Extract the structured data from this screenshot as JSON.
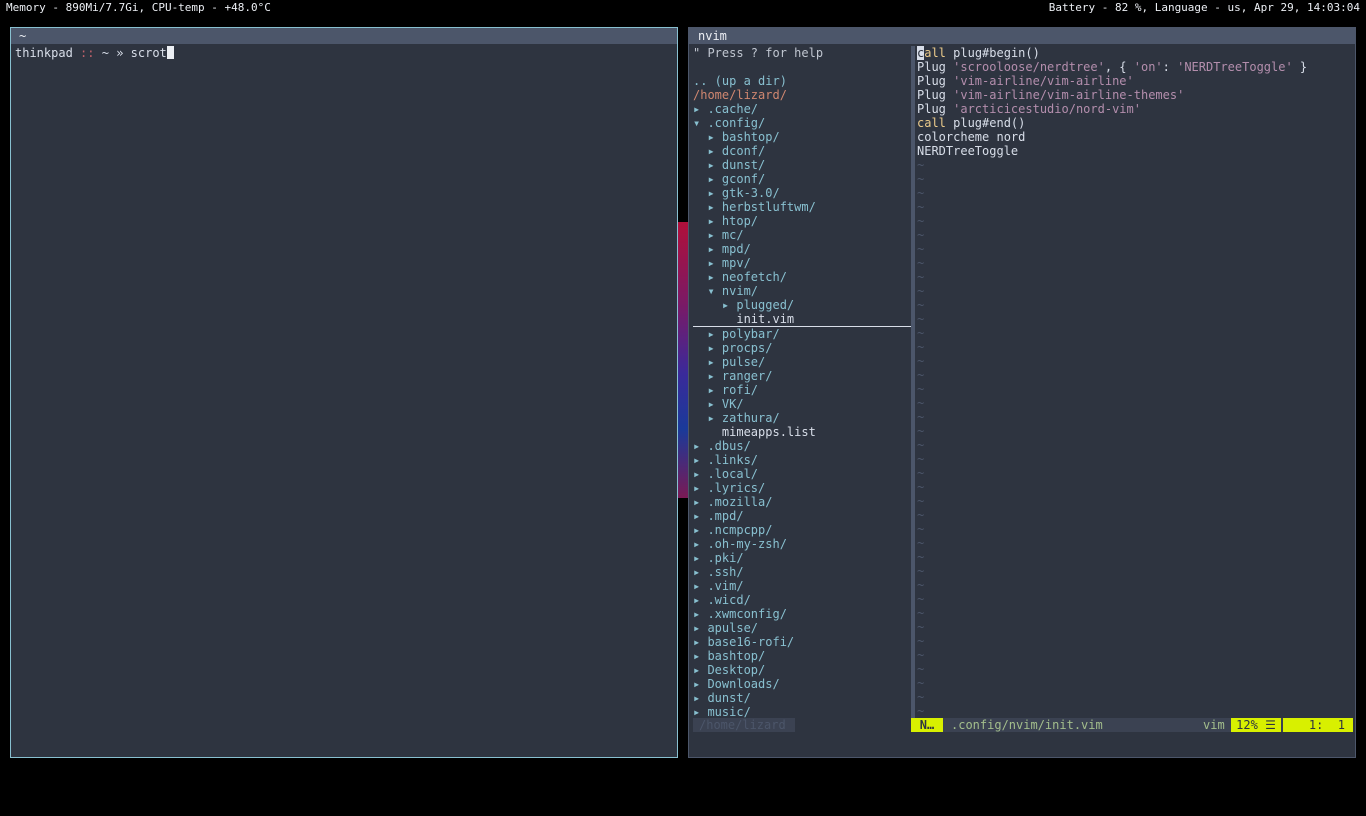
{
  "topbar": {
    "left": "Memory - 890Mi/7.7Gi, CPU-temp - +48.0°C",
    "right": "Battery - 82 %, Language - us, Apr 29, 14:03:04"
  },
  "terminal": {
    "title": "~",
    "host": "thinkpad",
    "sep": "::",
    "path": "~",
    "arrow": "»",
    "command": "scrot"
  },
  "nvim": {
    "title": "nvim",
    "tree": {
      "help": "\" Press ? for help",
      "updir": ".. (up a dir)",
      "root": "/home/lizard/",
      "items": [
        {
          "arrow": "▸",
          "indent": 0,
          "name": ".cache/"
        },
        {
          "arrow": "▾",
          "indent": 0,
          "name": ".config/"
        },
        {
          "arrow": "▸",
          "indent": 1,
          "name": "bashtop/"
        },
        {
          "arrow": "▸",
          "indent": 1,
          "name": "dconf/"
        },
        {
          "arrow": "▸",
          "indent": 1,
          "name": "dunst/"
        },
        {
          "arrow": "▸",
          "indent": 1,
          "name": "gconf/"
        },
        {
          "arrow": "▸",
          "indent": 1,
          "name": "gtk-3.0/"
        },
        {
          "arrow": "▸",
          "indent": 1,
          "name": "herbstluftwm/"
        },
        {
          "arrow": "▸",
          "indent": 1,
          "name": "htop/"
        },
        {
          "arrow": "▸",
          "indent": 1,
          "name": "mc/"
        },
        {
          "arrow": "▸",
          "indent": 1,
          "name": "mpd/"
        },
        {
          "arrow": "▸",
          "indent": 1,
          "name": "mpv/"
        },
        {
          "arrow": "▸",
          "indent": 1,
          "name": "neofetch/"
        },
        {
          "arrow": "▾",
          "indent": 1,
          "name": "nvim/"
        },
        {
          "arrow": "▸",
          "indent": 2,
          "name": "plugged/"
        },
        {
          "arrow": "",
          "indent": 2,
          "name": "init.vim",
          "file": true,
          "selected": true
        },
        {
          "arrow": "▸",
          "indent": 1,
          "name": "polybar/"
        },
        {
          "arrow": "▸",
          "indent": 1,
          "name": "procps/"
        },
        {
          "arrow": "▸",
          "indent": 1,
          "name": "pulse/"
        },
        {
          "arrow": "▸",
          "indent": 1,
          "name": "ranger/"
        },
        {
          "arrow": "▸",
          "indent": 1,
          "name": "rofi/"
        },
        {
          "arrow": "▸",
          "indent": 1,
          "name": "VK/"
        },
        {
          "arrow": "▸",
          "indent": 1,
          "name": "zathura/"
        },
        {
          "arrow": "",
          "indent": 1,
          "name": "mimeapps.list",
          "file": true
        },
        {
          "arrow": "▸",
          "indent": 0,
          "name": ".dbus/"
        },
        {
          "arrow": "▸",
          "indent": 0,
          "name": ".links/"
        },
        {
          "arrow": "▸",
          "indent": 0,
          "name": ".local/"
        },
        {
          "arrow": "▸",
          "indent": 0,
          "name": ".lyrics/"
        },
        {
          "arrow": "▸",
          "indent": 0,
          "name": ".mozilla/"
        },
        {
          "arrow": "▸",
          "indent": 0,
          "name": ".mpd/"
        },
        {
          "arrow": "▸",
          "indent": 0,
          "name": ".ncmpcpp/"
        },
        {
          "arrow": "▸",
          "indent": 0,
          "name": ".oh-my-zsh/"
        },
        {
          "arrow": "▸",
          "indent": 0,
          "name": ".pki/"
        },
        {
          "arrow": "▸",
          "indent": 0,
          "name": ".ssh/"
        },
        {
          "arrow": "▸",
          "indent": 0,
          "name": ".vim/"
        },
        {
          "arrow": "▸",
          "indent": 0,
          "name": ".wicd/"
        },
        {
          "arrow": "▸",
          "indent": 0,
          "name": ".xwmconfig/"
        },
        {
          "arrow": "▸",
          "indent": 0,
          "name": "apulse/"
        },
        {
          "arrow": "▸",
          "indent": 0,
          "name": "base16-rofi/"
        },
        {
          "arrow": "▸",
          "indent": 0,
          "name": "bashtop/"
        },
        {
          "arrow": "▸",
          "indent": 0,
          "name": "Desktop/"
        },
        {
          "arrow": "▸",
          "indent": 0,
          "name": "Downloads/"
        },
        {
          "arrow": "▸",
          "indent": 0,
          "name": "dunst/"
        },
        {
          "arrow": "▸",
          "indent": 0,
          "name": "music/"
        }
      ],
      "status": "/home/lizard"
    },
    "editor": {
      "lines": [
        [
          {
            "t": "c",
            "c": "ecur"
          },
          {
            "t": "all",
            "c": "kw2"
          },
          {
            "t": " plug#begin()",
            "c": ""
          }
        ],
        [
          {
            "t": "Plug ",
            "c": ""
          },
          {
            "t": "'scrooloose/nerdtree'",
            "c": "kw"
          },
          {
            "t": ", { ",
            "c": ""
          },
          {
            "t": "'on'",
            "c": "kw"
          },
          {
            "t": ": ",
            "c": ""
          },
          {
            "t": "'NERDTreeToggle'",
            "c": "kw"
          },
          {
            "t": " }",
            "c": ""
          }
        ],
        [
          {
            "t": "Plug ",
            "c": ""
          },
          {
            "t": "'vim-airline/vim-airline'",
            "c": "kw"
          }
        ],
        [
          {
            "t": "Plug ",
            "c": ""
          },
          {
            "t": "'vim-airline/vim-airline-themes'",
            "c": "kw"
          }
        ],
        [
          {
            "t": "Plug ",
            "c": ""
          },
          {
            "t": "'arcticicestudio/nord-vim'",
            "c": "kw"
          }
        ],
        [
          {
            "t": "call",
            "c": "kw2"
          },
          {
            "t": " plug#end()",
            "c": ""
          }
        ],
        [
          {
            "t": "colorcheme nord",
            "c": ""
          }
        ],
        [
          {
            "t": "NERDTreeToggle",
            "c": ""
          }
        ]
      ],
      "tilde": "~",
      "status": {
        "mode": "N…",
        "file": ".config/nvim/init.vim",
        "filetype": "vim",
        "percent": "12% ☰",
        "position": "1:  1"
      }
    }
  }
}
